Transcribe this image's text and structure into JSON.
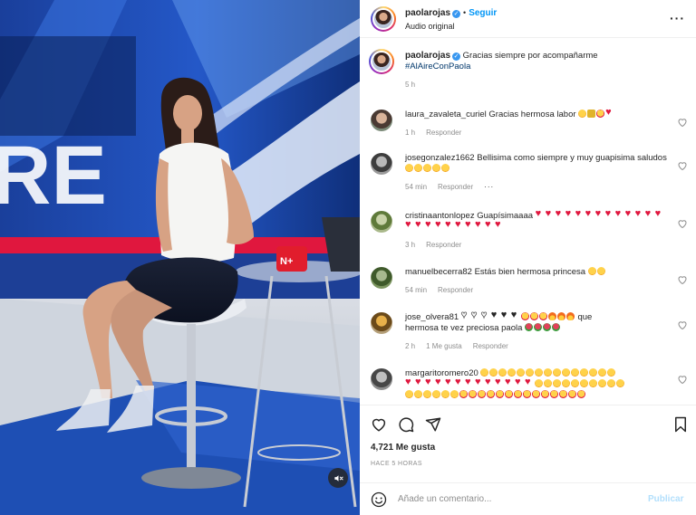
{
  "post": {
    "username": "paolarojas",
    "follow_label": "Seguir",
    "audio_label": "Audio original",
    "caption": "Gracias siempre por acompañarme",
    "hashtag": "#AlAireConPaola",
    "caption_time": "5 h",
    "likes": "4,721 Me gusta",
    "time_ago": "HACE 5 HORAS"
  },
  "video": {
    "muted": true,
    "mute_icon": "speaker-muted-icon"
  },
  "comments": [
    {
      "user": "laura_zavaleta_curiel",
      "text": "Gracias hermosa labor",
      "time": "1 h",
      "reply": "Responder"
    },
    {
      "user": "josegonzalez1662",
      "text": "Bellisima como siempre y muy guapisima saludos",
      "time": "54 min",
      "reply": "Responder"
    },
    {
      "user": "cristinaantonlopez",
      "text": "Guapísimaaaa",
      "time": "3 h",
      "reply": "Responder"
    },
    {
      "user": "manuelbecerra82",
      "text": "Estás bien hermosa princesa",
      "time": "54 min",
      "reply": "Responder"
    },
    {
      "user": "jose_olvera81",
      "text_a": "que",
      "text_b": "hermosa te vez preciosa paola",
      "time": "2 h",
      "likes": "1 Me gusta",
      "reply": "Responder"
    },
    {
      "user": "margaritoromero20",
      "text": ""
    }
  ],
  "comment_box": {
    "placeholder": "Añade un comentario...",
    "publish": "Publicar"
  },
  "colors": {
    "accent": "#0095f6",
    "heart": "#e0173e",
    "verified": "#3897f0",
    "muted_text": "#8e8e8e"
  },
  "icons": [
    "verified-badge-icon",
    "more-options-icon",
    "heart-icon",
    "comment-icon",
    "share-icon",
    "bookmark-icon",
    "emoji-icon",
    "speaker-muted-icon"
  ]
}
